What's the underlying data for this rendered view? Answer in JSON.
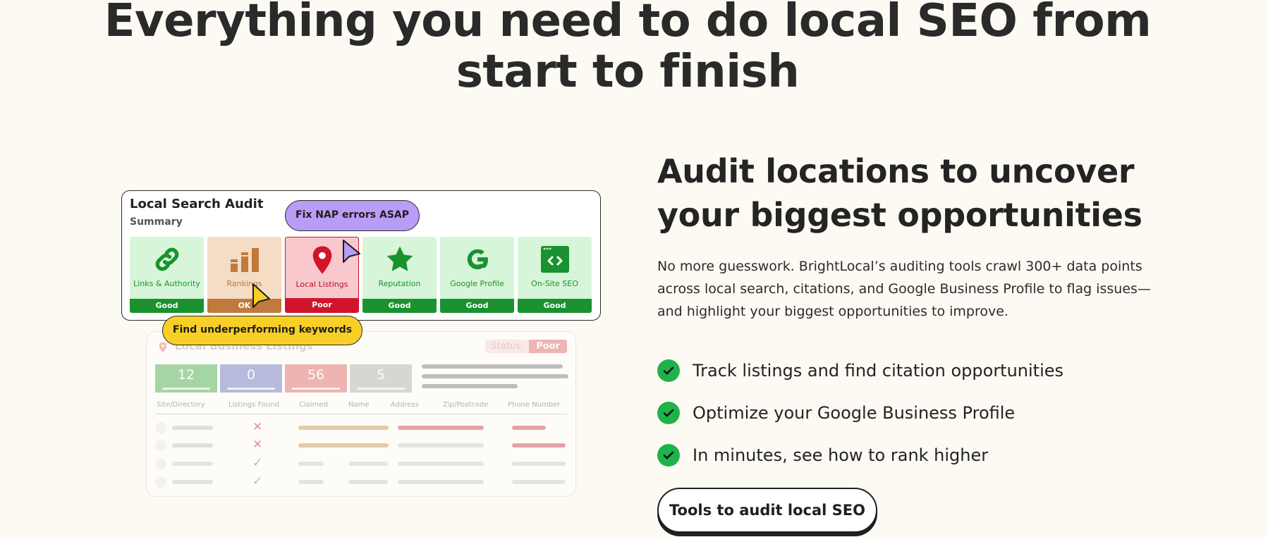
{
  "headline": "Everything you need to do local SEO from start to finish",
  "audit_card": {
    "title": "Local Search Audit",
    "subtitle": "Summary",
    "tiles": [
      {
        "label": "Links & Authority",
        "status": "Good",
        "icon": "link-icon"
      },
      {
        "label": "Rankings",
        "status": "OK",
        "icon": "bar-chart-icon"
      },
      {
        "label": "Local Listings",
        "status": "Poor",
        "icon": "map-pin-icon"
      },
      {
        "label": "Reputation",
        "status": "Good",
        "icon": "star-icon"
      },
      {
        "label": "Google Profile",
        "status": "Good",
        "icon": "google-g-icon"
      },
      {
        "label": "On-Site SEO",
        "status": "Good",
        "icon": "code-window-icon"
      }
    ]
  },
  "callouts": {
    "nap": "Fix NAP errors ASAP",
    "keywords": "Find underperforming keywords"
  },
  "listings_card": {
    "title": "Local Business Listings",
    "status_label": "Status:",
    "status_value": "Poor",
    "stats": [
      "12",
      "0",
      "56",
      "5"
    ],
    "columns": [
      "Site/Directory",
      "Listings Found",
      "Claimed",
      "Name",
      "Address",
      "Zip/Postcode",
      "Phone Number"
    ]
  },
  "section": {
    "heading": "Audit locations to uncover your biggest opportunities",
    "description": "No more guesswork. BrightLocal’s auditing tools crawl 300+ data points across local search, citations, and Google Business Profile to flag issues—and highlight your biggest opportunities to improve.",
    "features": [
      "Track listings and find citation opportunities",
      "Optimize your Google Business Profile",
      "In minutes, see how to rank higher"
    ],
    "cta": "Tools to audit local SEO"
  },
  "colors": {
    "good": "#19922f",
    "ok": "#c07a3c",
    "poor": "#d0142c",
    "nap_pill": "#b89cf5",
    "keyword_pill": "#f7cf26",
    "check": "#1fb24a"
  }
}
